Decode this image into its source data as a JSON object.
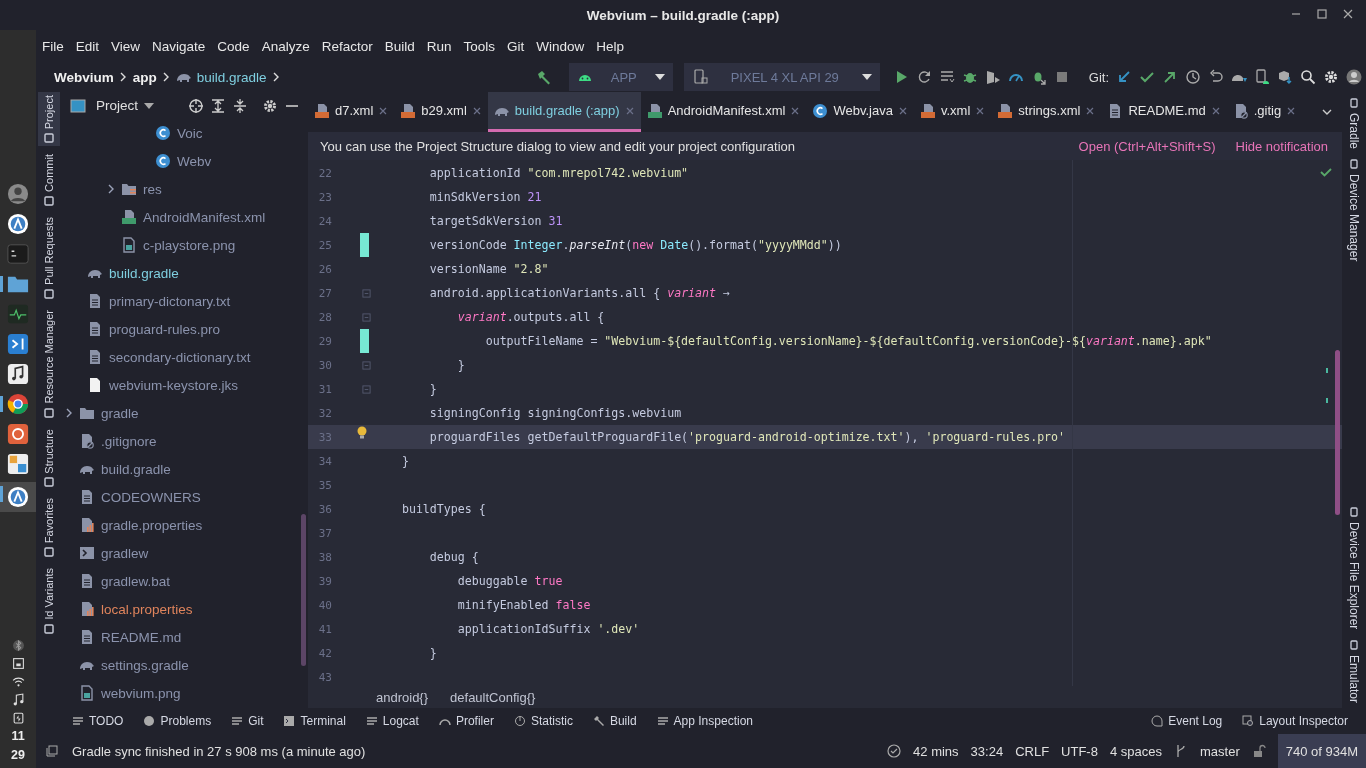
{
  "window": {
    "title": "Webvium – build.gradle (:app)"
  },
  "dock": {
    "apps": [
      {
        "kind": "avatar",
        "running": false,
        "selected": false
      },
      {
        "kind": "ide",
        "running": false,
        "selected": false
      },
      {
        "kind": "terminal",
        "running": false,
        "selected": false
      },
      {
        "kind": "files",
        "running": true,
        "selected": false
      },
      {
        "kind": "monitor",
        "running": false,
        "selected": false
      },
      {
        "kind": "code",
        "running": false,
        "selected": false
      },
      {
        "kind": "music",
        "running": false,
        "selected": false
      },
      {
        "kind": "browser",
        "running": true,
        "selected": false
      },
      {
        "kind": "updater",
        "running": false,
        "selected": false
      },
      {
        "kind": "office",
        "running": false,
        "selected": false
      },
      {
        "kind": "ide",
        "running": true,
        "selected": true
      }
    ],
    "clock": {
      "hour": "11",
      "minute": "29"
    }
  },
  "menu": [
    "File",
    "Edit",
    "View",
    "Navigate",
    "Code",
    "Analyze",
    "Refactor",
    "Build",
    "Run",
    "Tools",
    "Git",
    "Window",
    "Help"
  ],
  "breadcrumbs": [
    {
      "label": "Webvium",
      "kind": "plain"
    },
    {
      "label": "app",
      "kind": "plain"
    },
    {
      "label": "build.gradle",
      "kind": "gradle"
    }
  ],
  "run_config": {
    "module": "APP",
    "device": "PIXEL 4 XL API 29"
  },
  "git_label": "Git:",
  "left_tools": [
    {
      "label": "Project",
      "selected": true
    },
    {
      "label": "Commit",
      "selected": false
    },
    {
      "label": "Pull Requests",
      "selected": false
    },
    {
      "label": "Resource Manager",
      "selected": false
    },
    {
      "label": "Structure",
      "selected": false
    },
    {
      "label": "Favorites",
      "selected": false
    },
    {
      "label": "ld Variants",
      "selected": false
    }
  ],
  "project_panel": {
    "title": "Project",
    "tree": [
      {
        "children": [
          {
            "children": [
              {
                "children": [
                  {
                    "children": [
                      {
                        "children": [
                          {
                            "label": "Voic",
                            "kind": "class",
                            "color": "#8b93ad"
                          },
                          {
                            "label": "Webv",
                            "kind": "class",
                            "color": "#8b93ad"
                          }
                        ]
                      }
                    ]
                  },
                  {
                    "label": "res",
                    "kind": "res",
                    "color": "#8b93ad",
                    "expanded": false
                  },
                  {
                    "label": "AndroidManifest.xml",
                    "kind": "manifest",
                    "color": "#8b93ad"
                  },
                  {
                    "label": "c-playstore.png",
                    "kind": "image",
                    "color": "#8b93ad"
                  }
                ]
              }
            ]
          },
          {
            "label": "build.gradle",
            "kind": "gradle",
            "color": "#7fcfe0"
          },
          {
            "label": "primary-dictonary.txt",
            "kind": "text",
            "color": "#8b93ad"
          },
          {
            "label": "proguard-rules.pro",
            "kind": "text",
            "color": "#8b93ad"
          },
          {
            "label": "secondary-dictionary.txt",
            "kind": "text",
            "color": "#8b93ad"
          },
          {
            "label": "webvium-keystore.jks",
            "kind": "blank",
            "color": "#8b93ad"
          }
        ]
      },
      {
        "label": "gradle",
        "kind": "folder",
        "color": "#8b93ad",
        "expanded": false
      },
      {
        "label": ".gitignore",
        "kind": "ignore",
        "color": "#8b93ad"
      },
      {
        "label": "build.gradle",
        "kind": "gradle",
        "color": "#8b93ad"
      },
      {
        "label": "CODEOWNERS",
        "kind": "text",
        "color": "#8b93ad"
      },
      {
        "label": "gradle.properties",
        "kind": "properties",
        "color": "#8b93ad"
      },
      {
        "label": "gradlew",
        "kind": "script",
        "color": "#8b93ad"
      },
      {
        "label": "gradlew.bat",
        "kind": "text",
        "color": "#8b93ad"
      },
      {
        "label": "local.properties",
        "kind": "properties",
        "color": "#e0845c"
      },
      {
        "label": "README.md",
        "kind": "text",
        "color": "#8b93ad"
      },
      {
        "label": "settings.gradle",
        "kind": "gradle",
        "color": "#8b93ad"
      },
      {
        "label": "webvium.png",
        "kind": "image",
        "color": "#8b93ad"
      }
    ]
  },
  "tabs": [
    {
      "label": "d7.xml",
      "kind": "xml",
      "selected": false
    },
    {
      "label": "b29.xml",
      "kind": "xml",
      "selected": false
    },
    {
      "label": "build.gradle (:app)",
      "kind": "gradle",
      "selected": true
    },
    {
      "label": "AndroidManifest.xml",
      "kind": "manifest",
      "selected": false
    },
    {
      "label": "Webv.java",
      "kind": "class",
      "selected": false
    },
    {
      "label": "v.xml",
      "kind": "xml",
      "selected": false
    },
    {
      "label": "strings.xml",
      "kind": "xml",
      "selected": false
    },
    {
      "label": "README.md",
      "kind": "text",
      "selected": false
    },
    {
      "label": ".gitig",
      "kind": "ignore",
      "selected": false
    }
  ],
  "notification": {
    "message": "You can use the Project Structure dialog to view and edit your project configuration",
    "actions": [
      "Open (Ctrl+Alt+Shift+S)",
      "Hide notification"
    ]
  },
  "code": [
    {
      "number": "22",
      "kind": "plain",
      "current": false,
      "tokens": [
        {
          "t": "        applicationId ",
          "kind": "plain"
        },
        {
          "t": "\"com.mrepol742.webvium\"",
          "kind": "string"
        }
      ]
    },
    {
      "number": "23",
      "kind": "plain",
      "current": false,
      "tokens": [
        {
          "t": "        minSdkVersion ",
          "kind": "plain"
        },
        {
          "t": "21",
          "kind": "number"
        }
      ]
    },
    {
      "number": "24",
      "kind": "plain",
      "current": false,
      "tokens": [
        {
          "t": "        targetSdkVersion ",
          "kind": "plain"
        },
        {
          "t": "31",
          "kind": "number"
        }
      ]
    },
    {
      "number": "25",
      "kind": "change",
      "current": false,
      "tokens": [
        {
          "t": "        versionCode ",
          "kind": "plain"
        },
        {
          "t": "Integer",
          "kind": "class"
        },
        {
          "t": ".",
          "kind": "plain"
        },
        {
          "t": "parseInt",
          "kind": "method"
        },
        {
          "t": "(",
          "kind": "plain"
        },
        {
          "t": "new",
          "kind": "keyword"
        },
        {
          "t": " Date",
          "kind": "class"
        },
        {
          "t": "().format(",
          "kind": "plain"
        },
        {
          "t": "\"yyyyMMdd\"",
          "kind": "string"
        },
        {
          "t": "))",
          "kind": "plain"
        }
      ]
    },
    {
      "number": "26",
      "kind": "plain",
      "current": false,
      "tokens": [
        {
          "t": "        versionName ",
          "kind": "plain"
        },
        {
          "t": "\"2.8\"",
          "kind": "string"
        }
      ]
    },
    {
      "number": "27",
      "kind": "fold",
      "current": false,
      "tokens": [
        {
          "t": "        android.applicationVariants.all { ",
          "kind": "plain"
        },
        {
          "t": "variant",
          "kind": "variable"
        },
        {
          "t": " →",
          "kind": "plain"
        }
      ]
    },
    {
      "number": "28",
      "kind": "fold",
      "current": false,
      "tokens": [
        {
          "t": "            variant",
          "kind": "variable"
        },
        {
          "t": ".outputs.all {",
          "kind": "plain"
        }
      ]
    },
    {
      "number": "29",
      "kind": "change",
      "current": false,
      "tokens": [
        {
          "t": "                outputFileName = ",
          "kind": "plain"
        },
        {
          "t": "\"Webvium-${defaultConfig.versionName}-${defaultConfig.versionCode}-${",
          "kind": "string"
        },
        {
          "t": "variant",
          "kind": "variable"
        },
        {
          "t": ".name}.apk\"",
          "kind": "string"
        }
      ]
    },
    {
      "number": "30",
      "kind": "fold",
      "current": false,
      "tokens": [
        {
          "t": "            }",
          "kind": "plain"
        }
      ]
    },
    {
      "number": "31",
      "kind": "fold",
      "current": false,
      "tokens": [
        {
          "t": "        }",
          "kind": "plain"
        }
      ]
    },
    {
      "number": "32",
      "kind": "plain",
      "current": false,
      "tokens": [
        {
          "t": "        signingConfig signingConfigs.webvium",
          "kind": "plain"
        }
      ]
    },
    {
      "number": "33",
      "kind": "bulb",
      "current": true,
      "tokens": [
        {
          "t": "        proguardFiles getDefaultProguardFile(",
          "kind": "plain"
        },
        {
          "t": "'proguard-android-optimize.txt'",
          "kind": "string"
        },
        {
          "t": "), ",
          "kind": "plain"
        },
        {
          "t": "'proguard-rules.pro'",
          "kind": "string"
        }
      ]
    },
    {
      "number": "34",
      "kind": "plain",
      "current": false,
      "tokens": [
        {
          "t": "    }",
          "kind": "plain"
        }
      ]
    },
    {
      "number": "35",
      "kind": "plain",
      "current": false
    },
    {
      "number": "36",
      "kind": "plain",
      "current": false,
      "tokens": [
        {
          "t": "    buildTypes {",
          "kind": "plain"
        }
      ]
    },
    {
      "number": "37",
      "kind": "plain",
      "current": false
    },
    {
      "number": "38",
      "kind": "plain",
      "current": false,
      "tokens": [
        {
          "t": "        debug {",
          "kind": "plain"
        }
      ]
    },
    {
      "number": "39",
      "kind": "plain",
      "current": false,
      "tokens": [
        {
          "t": "            debuggable ",
          "kind": "plain"
        },
        {
          "t": "true",
          "kind": "keyword"
        }
      ]
    },
    {
      "number": "40",
      "kind": "plain",
      "current": false,
      "tokens": [
        {
          "t": "            minifyEnabled ",
          "kind": "plain"
        },
        {
          "t": "false",
          "kind": "keyword"
        }
      ]
    },
    {
      "number": "41",
      "kind": "plain",
      "current": false,
      "tokens": [
        {
          "t": "            applicationIdSuffix ",
          "kind": "plain"
        },
        {
          "t": "'.dev'",
          "kind": "string"
        }
      ]
    },
    {
      "number": "42",
      "kind": "plain",
      "current": false,
      "tokens": [
        {
          "t": "        }",
          "kind": "plain"
        }
      ]
    },
    {
      "number": "43",
      "kind": "plain",
      "current": false
    }
  ],
  "editor_breadcrumbs": [
    "android{}",
    "defaultConfig{}"
  ],
  "right_tools": [
    "Gradle",
    "Device Manager",
    "Device File Explorer",
    "Emulator"
  ],
  "bottom_tools": [
    {
      "label": "TODO",
      "kind": "list"
    },
    {
      "label": "Problems",
      "kind": "problems"
    },
    {
      "label": "Git",
      "kind": "git"
    },
    {
      "label": "Terminal",
      "kind": "terminal"
    },
    {
      "label": "Logcat",
      "kind": "log"
    },
    {
      "label": "Profiler",
      "kind": "gauge"
    },
    {
      "label": "Statistic",
      "kind": "pie"
    },
    {
      "label": "Build",
      "kind": "hammer"
    },
    {
      "label": "App Inspection",
      "kind": "inspect"
    }
  ],
  "bottom_tools_right": [
    {
      "label": "Event Log",
      "kind": "bubble"
    },
    {
      "label": "Layout Inspector",
      "kind": "layout"
    }
  ],
  "status_bar": {
    "message": "Gradle sync finished in 27 s 908 ms (a minute ago)",
    "timer": "42 mins",
    "position": "33:24",
    "line_ending": "CRLF",
    "encoding": "UTF-8",
    "indent": "4 spaces",
    "branch": "master",
    "memory": "740 of 934M"
  }
}
